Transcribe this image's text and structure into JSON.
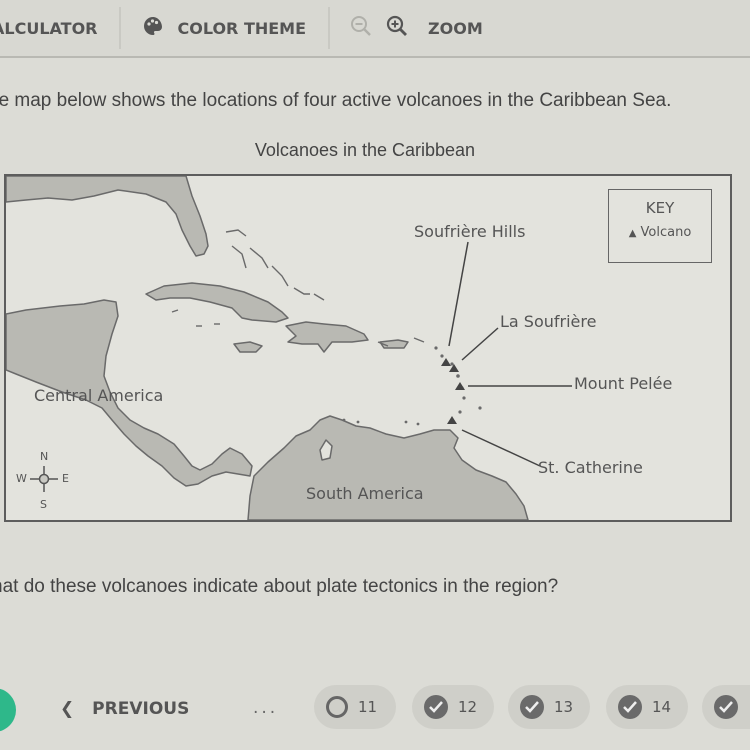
{
  "toolbar": {
    "calculator_label": "ALCULATOR",
    "color_theme_label": "COLOR THEME",
    "zoom_label": "ZOOM",
    "icons": [
      "palette-icon",
      "zoom-out-icon",
      "zoom-in-icon"
    ]
  },
  "question": {
    "intro": "he map below shows the locations of four active volcanoes in the Caribbean Sea.",
    "prompt": "hat do these volcanoes indicate about plate tectonics in the region?"
  },
  "map": {
    "title": "Volcanoes in the Caribbean",
    "regions": {
      "central_america": "Central America",
      "south_america": "South America"
    },
    "volcanoes": [
      {
        "name": "Soufrière Hills"
      },
      {
        "name": "La Soufrière"
      },
      {
        "name": "Mount Pelée"
      },
      {
        "name": "St. Catherine"
      }
    ],
    "key": {
      "title": "KEY",
      "symbol": "▲",
      "entry": "Volcano"
    },
    "compass": {
      "n": "N",
      "s": "S",
      "e": "E",
      "w": "W"
    },
    "colors": {
      "land": "#b9b9b3",
      "water": "#e3e3dd",
      "border": "#5d5d5d"
    }
  },
  "navigation": {
    "previous_label": "PREVIOUS",
    "ellipsis": "...",
    "questions": [
      {
        "number": "11",
        "status": "unanswered"
      },
      {
        "number": "12",
        "status": "answered"
      },
      {
        "number": "13",
        "status": "answered"
      },
      {
        "number": "14",
        "status": "answered"
      },
      {
        "number": "",
        "status": "answered"
      }
    ],
    "accent_color": "#2eb88a"
  }
}
